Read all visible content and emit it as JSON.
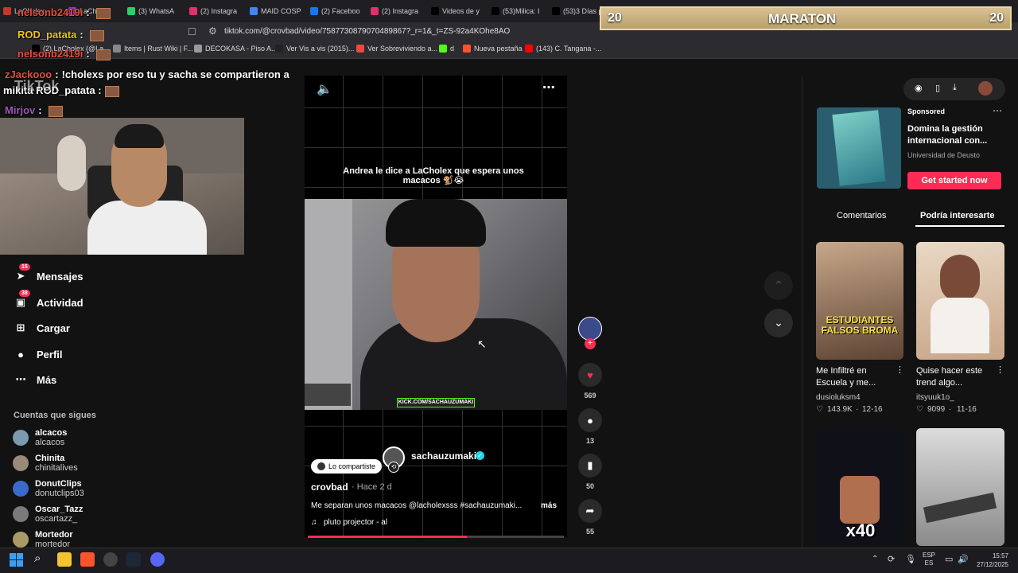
{
  "browser": {
    "tabs": [
      {
        "label": "LaCholex",
        "color": "#c0392b"
      },
      {
        "label": "LaCh",
        "color": "#8e44ad"
      },
      {
        "label": "(3) WhatsA",
        "color": "#25d366"
      },
      {
        "label": "(2) Instagra",
        "color": "#e1306c"
      },
      {
        "label": "MAID COSP",
        "color": "#4285f4"
      },
      {
        "label": "(2) Faceboo",
        "color": "#1877f2"
      },
      {
        "label": "(2) Instagra",
        "color": "#e1306c"
      },
      {
        "label": "Videos de y",
        "color": "#000000"
      },
      {
        "label": "(53)Milica: I",
        "color": "#000000"
      },
      {
        "label": "(53)3 Días p",
        "color": "#000000"
      }
    ],
    "url": "tiktok.com/@crovbad/video/7587730879070489867?_r=1&_t=ZS-92a4KOhe8AO",
    "bookmarks": [
      {
        "label": "(2) LaCholex (@La...",
        "color": "#000000"
      },
      {
        "label": "Items | Rust Wiki | F...",
        "color": "#888888"
      },
      {
        "label": "DECOKASA - Piso A...",
        "color": "#999999"
      },
      {
        "label": "Ver Vis a vis (2015)...",
        "color": "#222222"
      },
      {
        "label": "Ver Sobreviviendo a...",
        "color": "#e74c3c"
      },
      {
        "label": "d",
        "color": "#53fc18"
      },
      {
        "label": "Nueva pestaña",
        "color": "#fb542b"
      },
      {
        "label": "(143) C. Tangana -...",
        "color": "#ff0000"
      }
    ]
  },
  "overlay": {
    "maraton_title": "MARATON",
    "maraton_left": "20",
    "maraton_right": "20",
    "chat": [
      {
        "user": "nelsonb2419i",
        "sep": ":",
        "msg": "",
        "user_color": "#e74c3c"
      },
      {
        "user": "ROD_patata",
        "sep": ":",
        "msg": "",
        "user_color": "#f1c40f"
      },
      {
        "user": "nelsonb2419i",
        "sep": ":",
        "msg": "",
        "user_color": "#e74c3c"
      },
      {
        "user": "zJackooo",
        "sep": ":",
        "msg": "!cholexs por eso tu y sacha se compartieron a",
        "user_color": "#e74c3c"
      },
      {
        "user": "",
        "sep": "",
        "msg": "mikita ROD_patata :",
        "user_color": "#ffffff"
      },
      {
        "user": "Mirjov",
        "sep": ":",
        "msg": "",
        "user_color": "#9b59b6"
      }
    ],
    "tiktok_logo": "TikTok"
  },
  "sidebar": {
    "items": [
      {
        "label": "Mensajes",
        "icon": "paper-plane-icon",
        "badge": "15"
      },
      {
        "label": "Actividad",
        "icon": "inbox-icon",
        "badge": "38"
      },
      {
        "label": "Cargar",
        "icon": "plus-square-icon",
        "badge": ""
      },
      {
        "label": "Perfil",
        "icon": "avatar-icon",
        "badge": ""
      },
      {
        "label": "Más",
        "icon": "ellipsis-icon",
        "badge": ""
      }
    ],
    "following_title": "Cuentas que sigues",
    "following": [
      {
        "name": "alcacos",
        "handle": "alcacos"
      },
      {
        "name": "Chinita",
        "handle": "chinitalives"
      },
      {
        "name": "DonutClips",
        "handle": "donutclips03"
      },
      {
        "name": "Oscar_Tazz",
        "handle": "oscartazz_"
      },
      {
        "name": "Mortedor",
        "handle": "mortedor"
      }
    ]
  },
  "video": {
    "caption_overlay": "Andrea le dice a LaCholex que espera unos macacos 🐒😭",
    "watermark": "KICK.COM/SACHAUZUMAKI",
    "shared_label": "Lo compartiste",
    "featured_user": "sachauzumaki",
    "author": "crovbad",
    "time": "· Hace 2 d",
    "description": "Me separan unos macacos @lacholexsss #sachauzumaki...",
    "more": "más",
    "music": "pluto projector - al",
    "progress": 0.62
  },
  "actions": {
    "likes": "569",
    "comments": "13",
    "saves": "50",
    "shares": "55"
  },
  "right": {
    "sponsored_label": "Sponsored",
    "ad_title": "Domina la gestión internacional con...",
    "ad_brand": "Universidad de Deusto",
    "ad_button": "Get started now",
    "tab_comments": "Comentarios",
    "tab_interest": "Podría interesarte",
    "cards": [
      {
        "title": "Me Infiltré en Escuela y me...",
        "user": "dusioluksm4",
        "likes": "143.9K",
        "date": "12-16",
        "overlay": "ESTUDIANTES FALSOS BROMA"
      },
      {
        "title": "Quise hacer este trend algo...",
        "user": "itsyuuk1o_",
        "likes": "9099",
        "date": "11-16",
        "overlay": ""
      },
      {
        "title": "",
        "user": "",
        "likes": "",
        "date": "",
        "overlay": "x40"
      },
      {
        "title": "",
        "user": "",
        "likes": "",
        "date": "",
        "overlay": ""
      }
    ]
  },
  "taskbar": {
    "lang1": "ESP",
    "lang2": "ES",
    "time": "15:57",
    "date": "27/12/2025"
  }
}
